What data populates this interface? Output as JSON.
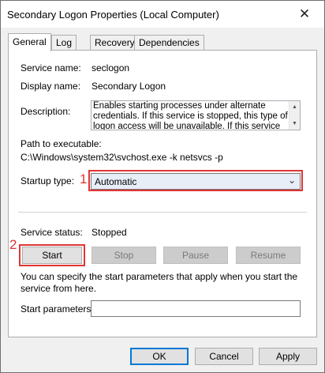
{
  "window": {
    "title": "Secondary Logon Properties (Local Computer)",
    "close_glyph": "✕"
  },
  "tabs": [
    {
      "label": "General",
      "active": true
    },
    {
      "label": "Log On",
      "active": false
    },
    {
      "label": "Recovery",
      "active": false
    },
    {
      "label": "Dependencies",
      "active": false
    }
  ],
  "general": {
    "service_name_label": "Service name:",
    "service_name_value": "seclogon",
    "display_name_label": "Display name:",
    "display_name_value": "Secondary Logon",
    "description_label": "Description:",
    "description_value": "Enables starting processes under alternate credentials. If this service is stopped, this type of logon access will be unavailable. If this service is disabled, any services that explicitly depend on it will fail to start.",
    "path_label": "Path to executable:",
    "path_value": "C:\\Windows\\system32\\svchost.exe -k netsvcs -p",
    "startup_type_label": "Startup type:",
    "startup_type_value": "Automatic",
    "service_status_label": "Service status:",
    "service_status_value": "Stopped",
    "hint_text": "You can specify the start parameters that apply when you start the service from here.",
    "start_params_label": "Start parameters:",
    "start_params_value": ""
  },
  "service_buttons": {
    "start": "Start",
    "stop": "Stop",
    "pause": "Pause",
    "resume": "Resume"
  },
  "dialog_buttons": {
    "ok": "OK",
    "cancel": "Cancel",
    "apply": "Apply"
  },
  "annotations": {
    "marker_1": "1",
    "marker_2": "2",
    "color": "#e03535"
  },
  "icons": {
    "dropdown": "chevron-down-icon",
    "close": "close-icon"
  }
}
